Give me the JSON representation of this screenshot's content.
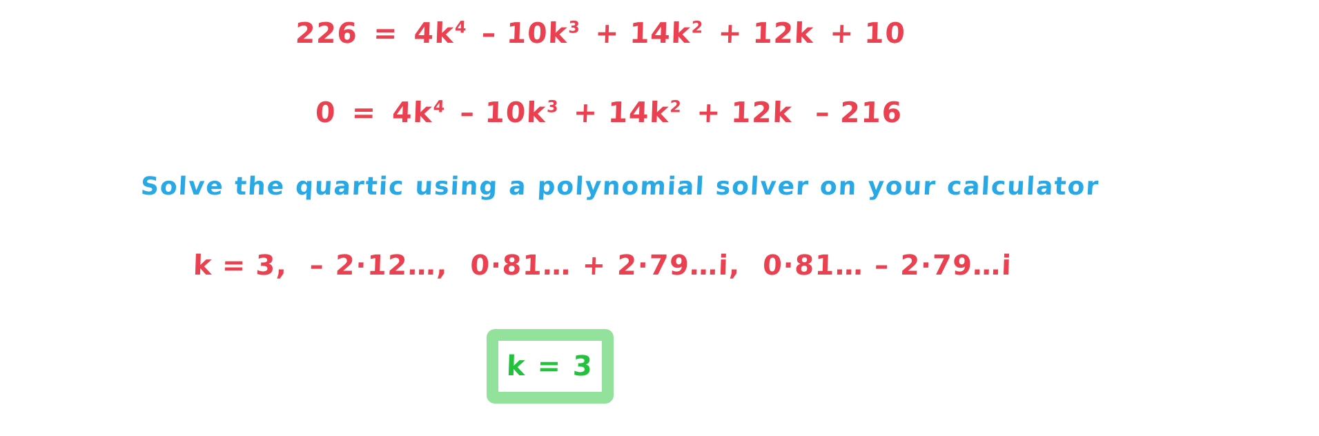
{
  "page": {
    "background_color": "#ffffff",
    "title": "Handwritten quartic equation solution"
  },
  "colors": {
    "working_red": "#ea4050",
    "annotation_blue": "#28a9e6",
    "answer_green": "#22c23c",
    "answer_box_border": "#93e29c"
  },
  "lines": {
    "equation_1": {
      "lhs": "226",
      "equals": "=",
      "terms": [
        {
          "coefficient": "4",
          "variable": "k",
          "exponent": "4",
          "sign": ""
        },
        {
          "coefficient": "10",
          "variable": "k",
          "exponent": "3",
          "sign": "–"
        },
        {
          "coefficient": "14",
          "variable": "k",
          "exponent": "2",
          "sign": "+"
        },
        {
          "coefficient": "12",
          "variable": "k",
          "exponent": "",
          "sign": "+"
        },
        {
          "coefficient": "10",
          "variable": "",
          "exponent": "",
          "sign": "+"
        }
      ],
      "plain_text": "226 = 4k⁴ – 10k³ + 14k² + 12k + 10",
      "color": "#ea4050"
    },
    "equation_2": {
      "lhs": "0",
      "equals": "=",
      "terms": [
        {
          "coefficient": "4",
          "variable": "k",
          "exponent": "4",
          "sign": ""
        },
        {
          "coefficient": "10",
          "variable": "k",
          "exponent": "3",
          "sign": "–"
        },
        {
          "coefficient": "14",
          "variable": "k",
          "exponent": "2",
          "sign": "+"
        },
        {
          "coefficient": "12",
          "variable": "k",
          "exponent": "",
          "sign": "+"
        },
        {
          "coefficient": "216",
          "variable": "",
          "exponent": "",
          "sign": "–"
        }
      ],
      "plain_text": "0 = 4k⁴ – 10k³ + 14k² + 12k – 216",
      "color": "#ea4050"
    },
    "instruction": {
      "words": [
        "Solve",
        "the",
        "quartic",
        "using",
        "a",
        "polynomial",
        "solver",
        "on",
        "your",
        "calculator"
      ],
      "plain_text": "Solve the quartic using a polynomial solver on your calculator",
      "color": "#28a9e6"
    },
    "roots": {
      "label": "k",
      "equals": "=",
      "values": [
        "3",
        "– 2·12…",
        "0·81… + 2·79…i",
        "0·81… – 2·79…i"
      ],
      "plain_text": "k = 3,  – 2·12…,  0·81…+2·79…i,  0·81…–2·79…i",
      "color": "#ea4050"
    }
  },
  "answer_box": {
    "text": "k = 3",
    "text_color": "#22c23c",
    "border_color": "#93e29c"
  }
}
